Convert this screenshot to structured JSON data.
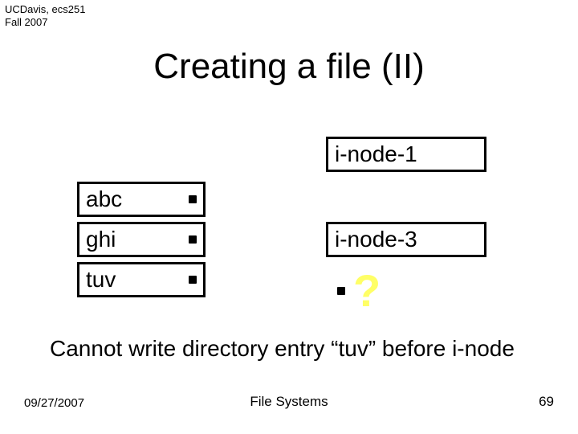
{
  "header": {
    "line1": "UCDavis, ecs251",
    "line2": "Fall 2007"
  },
  "title": "Creating a file (II)",
  "dir": {
    "row1": "abc",
    "row2": "ghi",
    "row3": "tuv"
  },
  "inodes": {
    "n1": "i-node-1",
    "n3": "i-node-3"
  },
  "question": "?",
  "caption": "Cannot write directory entry “tuv” before i-node",
  "footer": {
    "left": "09/27/2007",
    "center": "File Systems",
    "right": "69"
  }
}
